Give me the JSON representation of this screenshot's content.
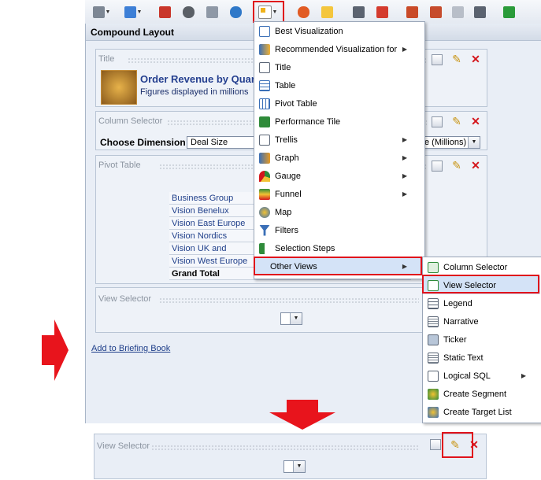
{
  "panel": {
    "title": "Compound Layout"
  },
  "sections": {
    "title": {
      "label": "Title",
      "heading": "Order Revenue by Quart",
      "subheading": "Figures displayed in millions"
    },
    "column_selector": {
      "label": "Column Selector",
      "choose_label": "Choose Dimension",
      "choose_value": "Deal Size",
      "right_value": "e (Millions)"
    },
    "pivot_table": {
      "label": "Pivot Table",
      "header": "Business Group",
      "rows": [
        "Vision Benelux",
        "Vision East Europe",
        "Vision Nordics",
        "Vision UK and Ireland",
        "Vision West Europe"
      ],
      "total_label": "Grand Total"
    },
    "view_selector": {
      "label": "View Selector"
    }
  },
  "briefing_link": "Add to Briefing Book",
  "menu": {
    "items": [
      {
        "label": "Best Visualization",
        "icon": "best-visualization-icon"
      },
      {
        "label": "Recommended Visualization for",
        "icon": "recommended-visualization-icon"
      },
      {
        "label": "Title",
        "icon": "title-view-icon"
      },
      {
        "label": "Table",
        "icon": "table-view-icon"
      },
      {
        "label": "Pivot Table",
        "icon": "pivot-table-icon"
      },
      {
        "label": "Performance Tile",
        "icon": "performance-tile-icon"
      },
      {
        "label": "Trellis",
        "icon": "trellis-icon"
      },
      {
        "label": "Graph",
        "icon": "graph-icon"
      },
      {
        "label": "Gauge",
        "icon": "gauge-icon"
      },
      {
        "label": "Funnel",
        "icon": "funnel-icon"
      },
      {
        "label": "Map",
        "icon": "map-icon"
      },
      {
        "label": "Filters",
        "icon": "filters-icon"
      },
      {
        "label": "Selection Steps",
        "icon": "selection-steps-icon"
      },
      {
        "label": "Other Views",
        "icon": ""
      }
    ]
  },
  "submenu": {
    "items": [
      {
        "label": "Column Selector",
        "icon": "column-selector-icon"
      },
      {
        "label": "View Selector",
        "icon": "view-selector-icon"
      },
      {
        "label": "Legend",
        "icon": "legend-icon"
      },
      {
        "label": "Narrative",
        "icon": "narrative-icon"
      },
      {
        "label": "Ticker",
        "icon": "ticker-icon"
      },
      {
        "label": "Static Text",
        "icon": "static-text-icon"
      },
      {
        "label": "Logical SQL",
        "icon": "logical-sql-icon"
      },
      {
        "label": "Create Segment",
        "icon": "create-segment-icon"
      },
      {
        "label": "Create Target List",
        "icon": "create-target-list-icon"
      }
    ]
  },
  "bottom_section": {
    "label": "View Selector"
  },
  "colors": {
    "highlight_red": "#e0121b",
    "selected_bg": "#d4e3f7",
    "link_blue": "#1f3f8a"
  }
}
